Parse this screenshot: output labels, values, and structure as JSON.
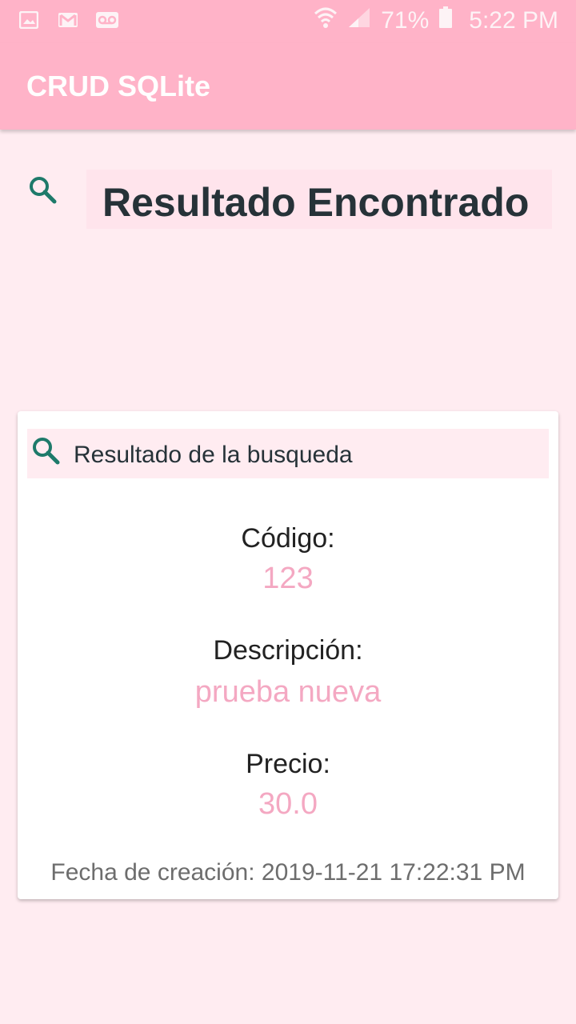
{
  "status_bar": {
    "battery": "71%",
    "time": "5:22 PM",
    "icons": [
      "image-icon",
      "gmail-icon",
      "voicemail-icon",
      "wifi-icon",
      "signal-icon",
      "battery-icon"
    ]
  },
  "app_bar": {
    "title": "CRUD SQLite"
  },
  "header": {
    "icon": "search-icon",
    "title": "Resultado Encontrado"
  },
  "card": {
    "header_icon": "search-icon",
    "header_text": "Resultado de la busqueda",
    "fields": [
      {
        "label": "Código:",
        "value": "123"
      },
      {
        "label": "Descripción:",
        "value": "prueba nueva"
      },
      {
        "label": "Precio:",
        "value": "30.0"
      }
    ],
    "created": "Fecha de creación: 2019-11-21 17:22:31 PM"
  },
  "colors": {
    "primary": "#ffb3c8",
    "background": "#ffecf1",
    "icon_accent": "#1e7a6a",
    "value_text": "#f4a8c2"
  }
}
